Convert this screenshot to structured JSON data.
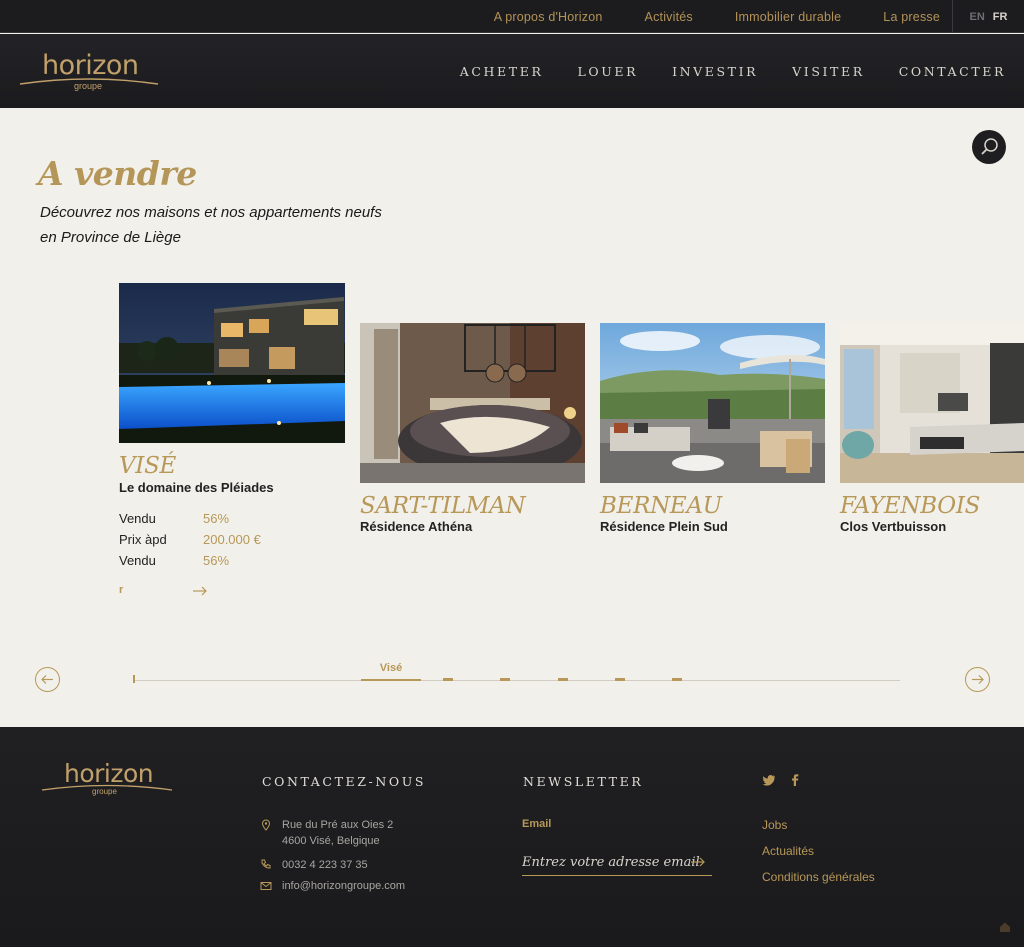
{
  "topbar": {
    "links": [
      "A propos d'Horizon",
      "Activités",
      "Immobilier durable",
      "La presse"
    ],
    "lang_en": "EN",
    "lang_fr": "FR"
  },
  "header": {
    "logo_word": "horizon",
    "logo_sub": "groupe",
    "nav": [
      "ACHETER",
      "LOUER",
      "INVESTIR",
      "VISITER",
      "CONTACTER"
    ]
  },
  "main": {
    "title": "A vendre",
    "intro_line1": "Découvrez nos maisons et nos appartements neufs",
    "intro_line2": "en Province de Liège",
    "search_icon": "search-icon"
  },
  "listings": [
    {
      "city": "VISÉ",
      "name": "Le domaine des Pléiades",
      "stats": [
        {
          "label": "Vendu",
          "value": "56%"
        },
        {
          "label": "Prix àpd",
          "value": "200.000 €"
        },
        {
          "label": "Vendu",
          "value": "56%"
        }
      ],
      "more_label": "r"
    },
    {
      "city": "SART-TILMAN",
      "name": "Résidence Athéna"
    },
    {
      "city": "BERNEAU",
      "name": "Résidence Plein Sud"
    },
    {
      "city": "FAYENBOIS",
      "name": "Clos Vertbuisson"
    }
  ],
  "slider": {
    "active_label": "Visé"
  },
  "footer": {
    "logo_word": "horizon",
    "logo_sub": "groupe",
    "contact_heading": "CONTACTEZ-NOUS",
    "address_line1": "Rue du Pré aux Oies 2",
    "address_line2": "4600 Visé, Belgique",
    "phone": "0032 4 223 37 35",
    "email": "info@horizongroupe.com",
    "newsletter_heading": "NEWSLETTER",
    "email_label": "Email",
    "email_placeholder": "Entrez votre adresse email",
    "links": [
      "Jobs",
      "Actualités",
      "Conditions générales"
    ]
  },
  "colors": {
    "gold": "#b79858",
    "dark": "#1c1c1e",
    "background": "#f2f0ea"
  }
}
